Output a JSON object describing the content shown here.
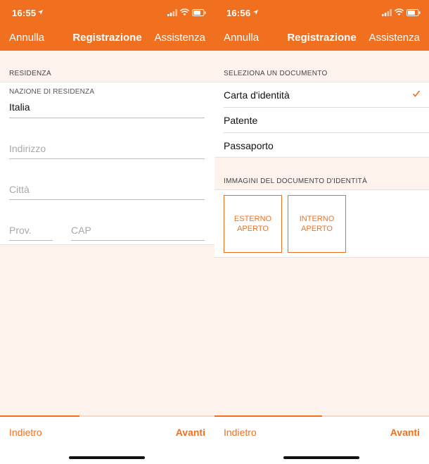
{
  "left": {
    "status": {
      "time": "16:55"
    },
    "nav": {
      "cancel": "Annulla",
      "title": "Registrazione",
      "help": "Assistenza"
    },
    "section_header": "RESIDENZA",
    "fields": {
      "country_label": "NAZIONE DI RESIDENZA",
      "country_value": "Italia",
      "address_placeholder": "Indirizzo",
      "city_placeholder": "Città",
      "province_placeholder": "Prov.",
      "zip_placeholder": "CAP"
    },
    "footer": {
      "back": "Indietro",
      "next": "Avanti",
      "progress": 0.37
    }
  },
  "right": {
    "status": {
      "time": "16:56"
    },
    "nav": {
      "cancel": "Annulla",
      "title": "Registrazione",
      "help": "Assistenza"
    },
    "doc_header": "SELEZIONA UN DOCUMENTO",
    "documents": [
      {
        "label": "Carta d'identità",
        "selected": true
      },
      {
        "label": "Patente",
        "selected": false
      },
      {
        "label": "Passaporto",
        "selected": false
      }
    ],
    "images_header": "IMMAGINI DEL DOCUMENTO D'IDENTITÀ",
    "image_buttons": {
      "outside_line1": "ESTERNO",
      "outside_line2": "APERTO",
      "inside_line1": "INTERNO",
      "inside_line2": "APERTO"
    },
    "footer": {
      "back": "Indietro",
      "next": "Avanti",
      "progress": 0.5
    }
  },
  "colors": {
    "accent": "#f07020",
    "background": "#fdf3ec"
  }
}
